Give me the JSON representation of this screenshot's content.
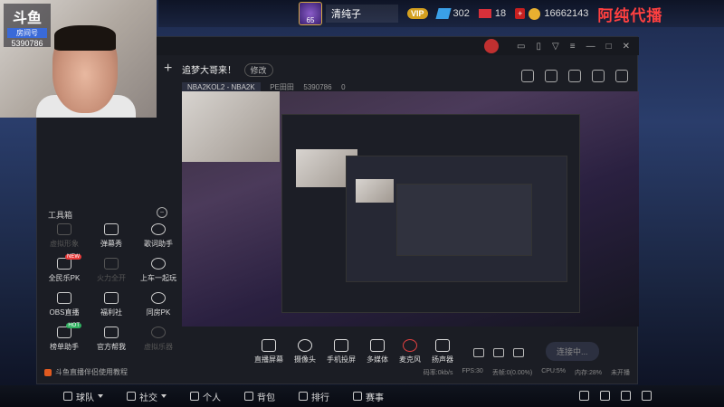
{
  "topbar": {
    "rank_level": "65",
    "player_name": "清纯子",
    "vip_label": "VIP",
    "gems": "302",
    "tickets": "18",
    "coins": "16662143",
    "streamer_name": "阿纯代播"
  },
  "webcam": {
    "logo_title": "斗鱼",
    "logo_tag": "房间号",
    "room_number": "5390786"
  },
  "app": {
    "room_title": "追梦大哥来！",
    "edit_label": "修改",
    "category": "NBA2KOL2 - NBA2K",
    "platform": "PE田田",
    "room_id": "5390786",
    "heat": "0",
    "plus_label": "+"
  },
  "tools": {
    "title": "工具箱",
    "collapse_icon": "−",
    "items": [
      {
        "label": "虚拟形象",
        "dim": true
      },
      {
        "label": "弹幕秀",
        "dim": false
      },
      {
        "label": "歌词助手",
        "dim": false
      },
      {
        "label": "全民乐PK",
        "dim": false,
        "badge": "NEW"
      },
      {
        "label": "火力全开",
        "dim": true
      },
      {
        "label": "上车一起玩",
        "dim": false
      },
      {
        "label": "OBS直播",
        "dim": false
      },
      {
        "label": "福利社",
        "dim": false
      },
      {
        "label": "同房PK",
        "dim": false
      },
      {
        "label": "榜单助手",
        "dim": false,
        "badge": "HOT"
      },
      {
        "label": "官方帮我",
        "dim": false
      },
      {
        "label": "虚拟乐器",
        "dim": true
      }
    ],
    "tutorial": "斗鱼直播伴侣使用教程"
  },
  "bottom_toolbar": {
    "items": [
      "直播屏幕",
      "摄像头",
      "手机投屏",
      "多媒体",
      "麦克风",
      "扬声器"
    ],
    "connect": "连接中..."
  },
  "statusbar": {
    "bitrate": "码率:0kb/s",
    "fps": "FPS:30",
    "dropped": "丢帧:0(0.00%)",
    "cpu": "CPU:5%",
    "mem": "内存:28%",
    "status": "未开播"
  },
  "gamenav": {
    "items": [
      "球队",
      "社交",
      "个人",
      "背包",
      "排行",
      "赛事"
    ]
  }
}
